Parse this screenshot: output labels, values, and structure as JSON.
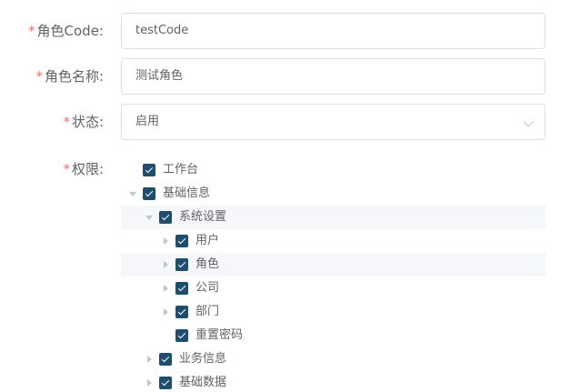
{
  "form": {
    "required_mark": "*",
    "code": {
      "label": "角色Code:",
      "value": "testCode"
    },
    "name": {
      "label": "角色名称:",
      "value": "测试角色"
    },
    "status": {
      "label": "状态:",
      "value": "启用"
    },
    "permissions": {
      "label": "权限:"
    }
  },
  "tree": {
    "nodes": [
      {
        "label": "工作台",
        "level": 0,
        "caret": "none",
        "checked": true
      },
      {
        "label": "基础信息",
        "level": 0,
        "caret": "down",
        "checked": true
      },
      {
        "label": "系统设置",
        "level": 1,
        "caret": "down",
        "checked": true,
        "highlight": true
      },
      {
        "label": "用户",
        "level": 2,
        "caret": "right",
        "checked": true
      },
      {
        "label": "角色",
        "level": 2,
        "caret": "right",
        "checked": true,
        "highlight": true
      },
      {
        "label": "公司",
        "level": 2,
        "caret": "right",
        "checked": true
      },
      {
        "label": "部门",
        "level": 2,
        "caret": "right",
        "checked": true
      },
      {
        "label": "重置密码",
        "level": 2,
        "caret": "none",
        "checked": true
      },
      {
        "label": "业务信息",
        "level": 1,
        "caret": "right",
        "checked": true
      },
      {
        "label": "基础数据",
        "level": 1,
        "caret": "right",
        "checked": true
      }
    ]
  },
  "colors": {
    "required": "#f56c6c",
    "checkbox": "#1e4d6e",
    "highlight_row": "#f5f7fa",
    "border": "#dcdfe6"
  }
}
